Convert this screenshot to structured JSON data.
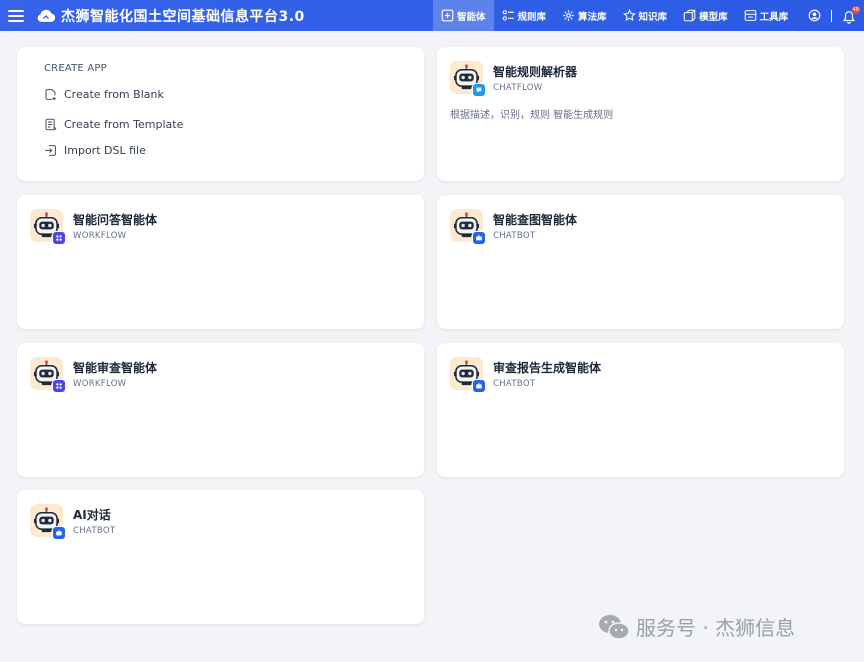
{
  "header": {
    "title": "杰狮智能化国土空间基础信息平台3.0",
    "nav": [
      {
        "label": "智能体",
        "icon": "agent-icon",
        "active": true
      },
      {
        "label": "规则库",
        "icon": "rules-icon",
        "active": false
      },
      {
        "label": "算法库",
        "icon": "algorithm-icon",
        "active": false
      },
      {
        "label": "知识库",
        "icon": "knowledge-icon",
        "active": false
      },
      {
        "label": "模型库",
        "icon": "model-icon",
        "active": false
      },
      {
        "label": "工具库",
        "icon": "tools-icon",
        "active": false
      }
    ],
    "notification_count": "48"
  },
  "create": {
    "title": "CREATE APP",
    "blank": "Create from Blank",
    "template": "Create from Template",
    "import": "Import DSL file"
  },
  "apps": [
    {
      "name": "智能规则解析器",
      "mode": "CHATFLOW",
      "desc": "根据描述，识别，规则 智能生成规则"
    },
    {
      "name": "智能问答智能体",
      "mode": "WORKFLOW",
      "desc": ""
    },
    {
      "name": "智能查图智能体",
      "mode": "CHATBOT",
      "desc": ""
    },
    {
      "name": "智能审查智能体",
      "mode": "WORKFLOW",
      "desc": ""
    },
    {
      "name": "审查报告生成智能体",
      "mode": "CHATBOT",
      "desc": ""
    },
    {
      "name": "AI对话",
      "mode": "CHATBOT",
      "desc": ""
    }
  ],
  "watermark": "服务号 · 杰狮信息",
  "colors": {
    "header": "#3563e9",
    "chatflow": "#1d9bf0",
    "workflow": "#4f46e5",
    "chatbot": "#2563eb",
    "avatar_bg": "#fde9cf"
  }
}
